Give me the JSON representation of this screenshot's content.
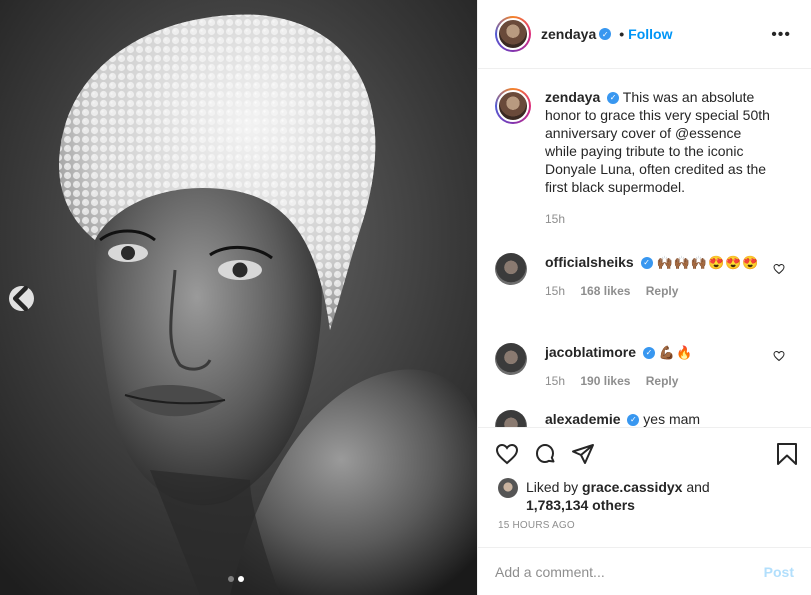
{
  "post": {
    "author": "zendaya",
    "follow_label": "Follow",
    "bullet": "•",
    "more_label": "•••"
  },
  "caption": {
    "author": "zendaya",
    "text": "This was an absolute honor to grace this very special 50th anniversary cover of @essence while paying tribute to the iconic Donyale Luna, often credited as the first black supermodel.",
    "time": "15h"
  },
  "comments": [
    {
      "author": "officialsheiks",
      "text": "🙌🏾🙌🏾🙌🏾😍😍😍",
      "time": "15h",
      "likes": "168 likes",
      "reply": "Reply"
    },
    {
      "author": "jacoblatimore",
      "text": "💪🏾🔥",
      "time": "15h",
      "likes": "190 likes",
      "reply": "Reply"
    },
    {
      "author": "alexademie",
      "text": "yes mam"
    }
  ],
  "likes": {
    "prefix": "Liked by",
    "user": "grace.cassidyx",
    "middle": "and",
    "count": "1,783,134 others"
  },
  "timestamp": "15 HOURS AGO",
  "add_comment": {
    "placeholder": "Add a comment...",
    "post_label": "Post"
  },
  "carousel": {
    "total": 2,
    "current": 2
  },
  "icons": [
    "chevron-left-icon",
    "verified-icon",
    "more-icon",
    "heart-icon",
    "comment-icon",
    "share-icon",
    "bookmark-icon"
  ],
  "colors": {
    "link": "#0095f6",
    "verified": "#3897f0",
    "muted": "#8e8e8e"
  }
}
